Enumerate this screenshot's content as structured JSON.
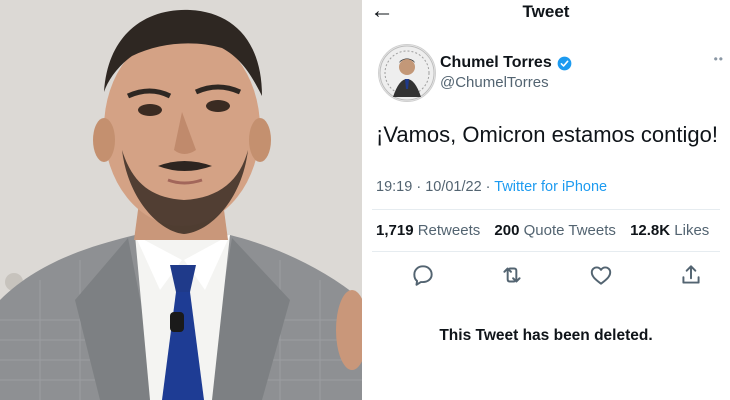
{
  "tweet": {
    "header_title": "Tweet",
    "back_icon": "arrow-left-icon",
    "user": {
      "name": "Chumel Torres",
      "handle": "@ChumelTorres",
      "verified_icon": "verified-badge-icon"
    },
    "more_icon": "more-dots-icon",
    "text": "¡Vamos, Omicron estamos contigo!",
    "time": "19:19",
    "separator": " · ",
    "date": "10/01/22",
    "separator2": " · ",
    "app": "Twitter for iPhone",
    "stats": {
      "retweets_count": "1,719",
      "retweets_label": "Retweets",
      "quotes_count": "200",
      "quotes_label": "Quote Tweets",
      "likes_count": "12.8K",
      "likes_label": "Likes"
    },
    "actions": [
      "reply-icon",
      "retweet-icon",
      "like-icon",
      "share-icon"
    ],
    "deleted_notice": "This Tweet has been deleted."
  },
  "colors": {
    "link": "#1d9bf0",
    "text_primary": "#0f1419",
    "text_secondary": "#536471"
  }
}
